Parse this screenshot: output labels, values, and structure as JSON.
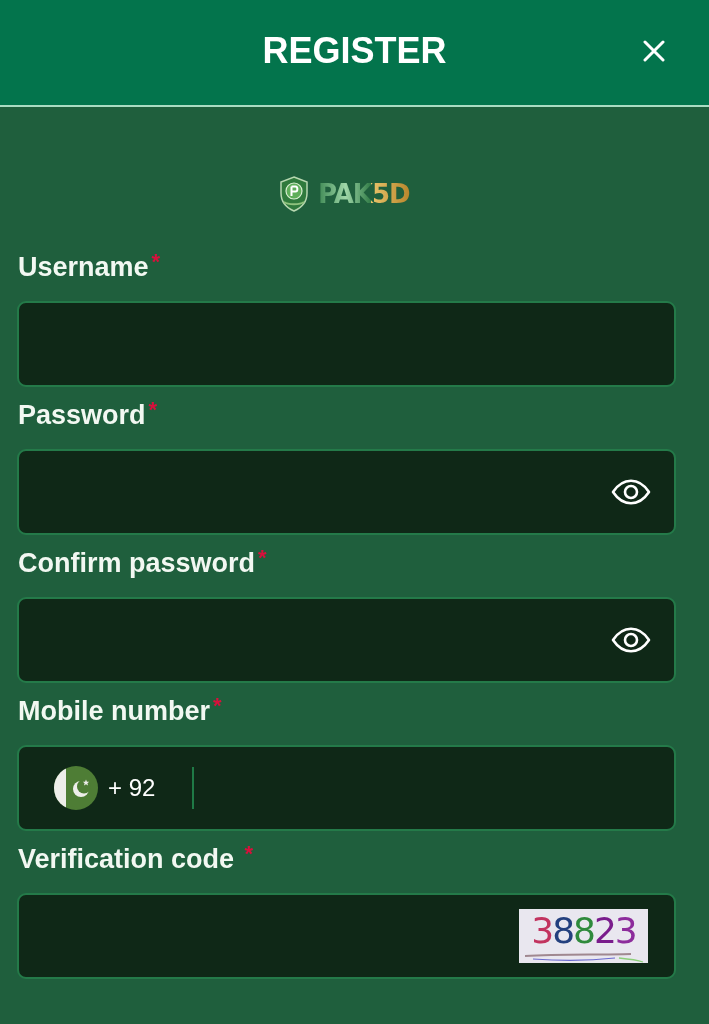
{
  "header": {
    "title": "REGISTER"
  },
  "logo": {
    "text": "PAK5D"
  },
  "fields": [
    {
      "kind": "text",
      "label": "Username$^{*}$"
    },
    {
      "kind": "password",
      "label": "Password$^{*}$"
    },
    {
      "kind": "password",
      "label": "Confirm password$^{*}$"
    },
    {
      "kind": "phone",
      "label": "Mobile number$^{*}$",
      "country_code": "+ 92"
    },
    {
      "kind": "captcha",
      "label": "Verification code $^{*}$",
      "captcha": "38823"
    }
  ]
}
